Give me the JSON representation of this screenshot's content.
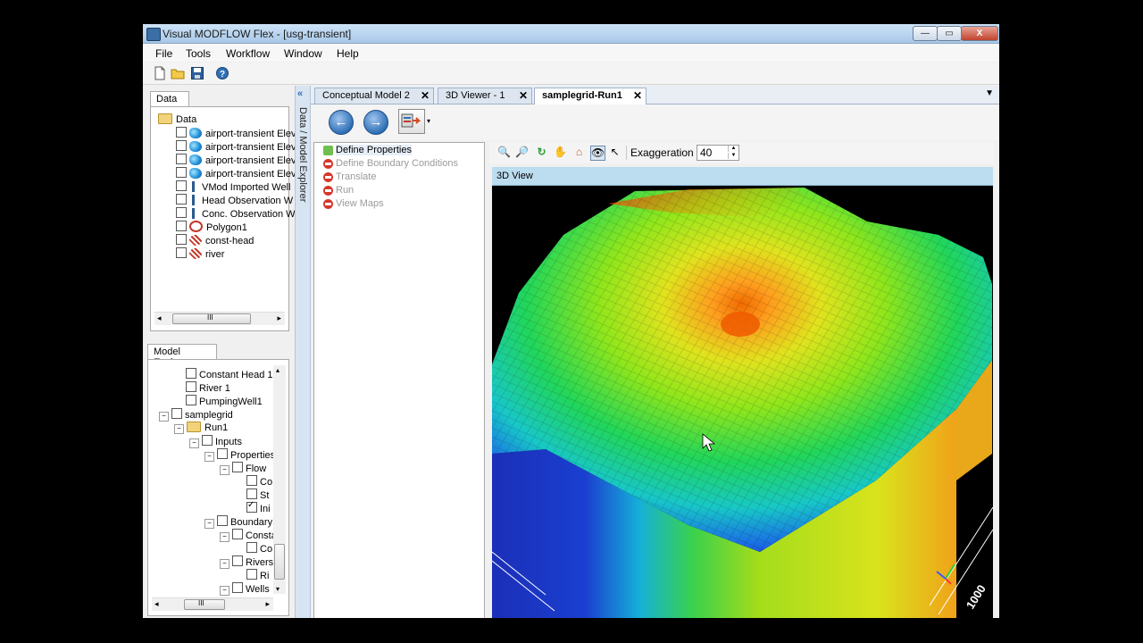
{
  "window": {
    "title": "Visual MODFLOW Flex - [usg-transient]",
    "controls": {
      "minimize": "—",
      "maximize": "▭",
      "close": "X"
    }
  },
  "menu": [
    "File",
    "Tools",
    "Workflow",
    "Window",
    "Help"
  ],
  "data_panel": {
    "tab": "Data",
    "root": "Data",
    "items": [
      {
        "label": "airport-transient Elev",
        "icon": "surface-icon"
      },
      {
        "label": "airport-transient Elev",
        "icon": "surface-icon"
      },
      {
        "label": "airport-transient Elev",
        "icon": "surface-icon"
      },
      {
        "label": "airport-transient Elev",
        "icon": "surface-icon"
      },
      {
        "label": "VMod Imported Well",
        "icon": "well-icon"
      },
      {
        "label": "Head Observation W",
        "icon": "well-icon"
      },
      {
        "label": "Conc. Observation W",
        "icon": "well-icon"
      },
      {
        "label": "Polygon1",
        "icon": "polygon-icon"
      },
      {
        "label": "const-head",
        "icon": "hatch-icon"
      },
      {
        "label": "river",
        "icon": "hatch-icon"
      }
    ],
    "scroll_grip": "III"
  },
  "model_explorer": {
    "tab": "Model Explorer",
    "items": [
      {
        "label": "Constant Head  1",
        "indent": 1,
        "expander": "",
        "folder": false,
        "checked": false
      },
      {
        "label": "River  1",
        "indent": 1,
        "expander": "",
        "folder": false,
        "checked": false
      },
      {
        "label": "PumpingWell1",
        "indent": 1,
        "expander": "",
        "folder": false,
        "checked": false
      },
      {
        "label": "samplegrid",
        "indent": 0,
        "expander": "−",
        "folder": false,
        "checked": false
      },
      {
        "label": "Run1",
        "indent": 1,
        "expander": "−",
        "folder": true,
        "checked": null
      },
      {
        "label": "Inputs",
        "indent": 2,
        "expander": "−",
        "folder": false,
        "checked": false
      },
      {
        "label": "Properties",
        "indent": 3,
        "expander": "−",
        "folder": false,
        "checked": false
      },
      {
        "label": "Flow",
        "indent": 4,
        "expander": "−",
        "folder": false,
        "checked": false
      },
      {
        "label": "Co",
        "indent": 5,
        "expander": "",
        "folder": false,
        "checked": false
      },
      {
        "label": "St",
        "indent": 5,
        "expander": "",
        "folder": false,
        "checked": false
      },
      {
        "label": "Ini",
        "indent": 5,
        "expander": "",
        "folder": false,
        "checked": true
      },
      {
        "label": "Boundary C",
        "indent": 3,
        "expander": "−",
        "folder": false,
        "checked": false
      },
      {
        "label": "Consta",
        "indent": 4,
        "expander": "−",
        "folder": false,
        "checked": false
      },
      {
        "label": "Co",
        "indent": 5,
        "expander": "",
        "folder": false,
        "checked": false
      },
      {
        "label": "Rivers",
        "indent": 4,
        "expander": "−",
        "folder": false,
        "checked": false
      },
      {
        "label": "Ri",
        "indent": 5,
        "expander": "",
        "folder": false,
        "checked": false
      },
      {
        "label": "Wells",
        "indent": 4,
        "expander": "−",
        "folder": false,
        "checked": false
      }
    ],
    "scroll_grip": "III"
  },
  "side_bar_label": "Data / Model Explorer",
  "doc_tabs": [
    {
      "label": "Conceptual Model 2",
      "close": "✕",
      "active": false
    },
    {
      "label": "3D Viewer - 1",
      "close": "✕",
      "active": false
    },
    {
      "label": "samplegrid-Run1",
      "close": "✕",
      "active": true
    }
  ],
  "nav": {
    "back": "←",
    "forward": "→",
    "dropdown": "▾"
  },
  "workflow_steps": [
    {
      "label": "Define Properties",
      "state": "active"
    },
    {
      "label": "Define Boundary Conditions",
      "state": "disabled"
    },
    {
      "label": "Translate",
      "state": "disabled"
    },
    {
      "label": "Run",
      "state": "disabled"
    },
    {
      "label": "View Maps",
      "state": "disabled"
    }
  ],
  "viewer": {
    "exaggeration_label": "Exaggeration",
    "exaggeration_value": "40",
    "view_title": "3D View",
    "axis_label": "1000",
    "axis_letter": "Y"
  },
  "colors": {
    "accent": "#2f6fb6",
    "view_header": "#bcdcef",
    "stop": "#d6372a",
    "go": "#6fbf4f"
  }
}
